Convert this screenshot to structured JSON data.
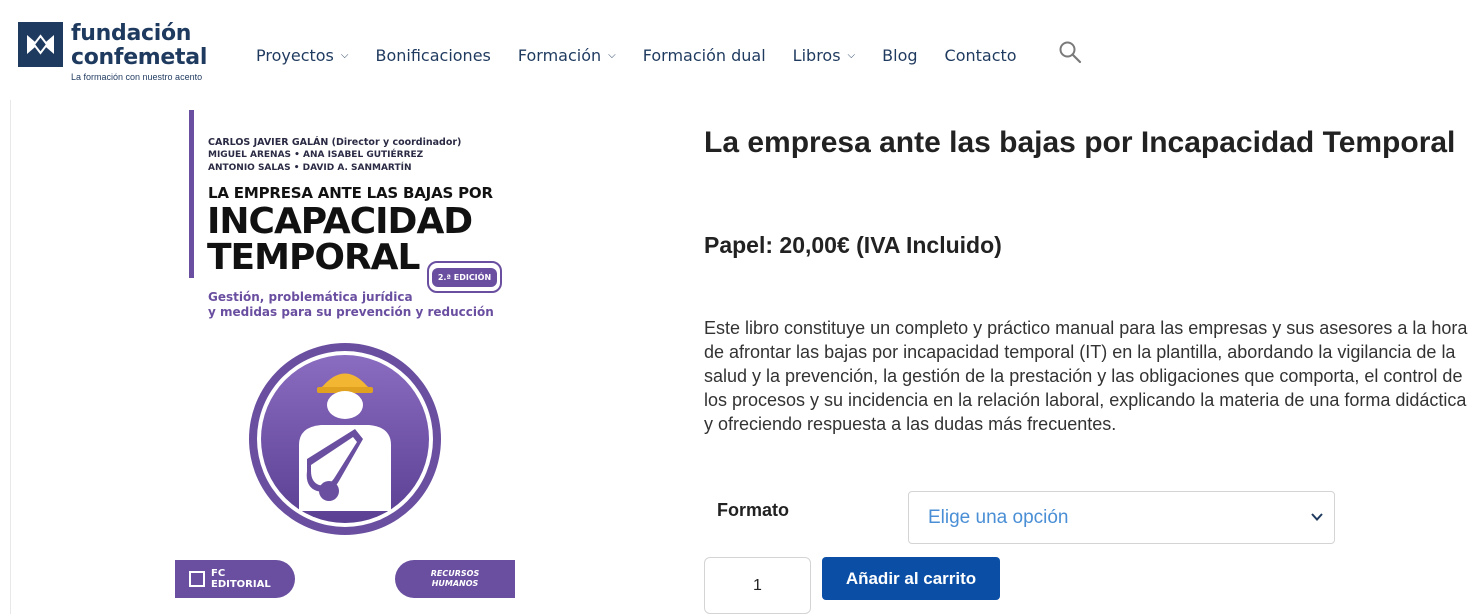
{
  "header": {
    "logo": {
      "line1": "fundación",
      "line2": "confemetal",
      "tagline": "La formación con nuestro acento"
    },
    "nav": [
      {
        "label": "Proyectos",
        "has_dropdown": true
      },
      {
        "label": "Bonificaciones",
        "has_dropdown": false
      },
      {
        "label": "Formación",
        "has_dropdown": true
      },
      {
        "label": "Formación dual",
        "has_dropdown": false
      },
      {
        "label": "Libros",
        "has_dropdown": true
      },
      {
        "label": "Blog",
        "has_dropdown": false
      },
      {
        "label": "Contacto",
        "has_dropdown": false
      }
    ],
    "chevron_glyph": "⌵",
    "search_icon": "search-icon"
  },
  "cover": {
    "authors_lead": "CARLOS JAVIER GALÁN (Director y coordinador)",
    "authors_2": "MIGUEL ARENAS  •  ANA ISABEL GUTIÉRREZ",
    "authors_3": "ANTONIO SALAS  •  DAVID A. SANMARTÍN",
    "kicker": "LA EMPRESA ANTE LAS BAJAS POR",
    "title_1": "INCAPACIDAD",
    "title_2": "TEMPORAL",
    "edition": "2.ª EDICIÓN",
    "subtitle_1": "Gestión, problemática jurídica",
    "subtitle_2": "y medidas para su prevención y reducción",
    "publisher_1": "FC",
    "publisher_2": "EDITORIAL",
    "collection_1": "RECURSOS",
    "collection_2": "HUMANOS",
    "accent_color": "#6a4fa0"
  },
  "product": {
    "title": "La empresa ante las bajas por Incapacidad Temporal",
    "price": "Papel: 20,00€ (IVA Incluido)",
    "description": "Este libro constituye un completo y práctico manual para las empresas y sus asesores a la hora de afrontar las bajas por incapacidad temporal (IT) en la plantilla, abordando la vigilancia de la salud y la prevención, la gestión de la prestación y las obligaciones que comporta, el control de los procesos y su incidencia en la relación laboral, explicando la materia de una forma didáctica y ofreciendo respuesta a las dudas más frecuentes.",
    "format_label": "Formato",
    "format_placeholder": "Elige una opción",
    "quantity": "1",
    "add_to_cart": "Añadir al carrito",
    "button_color": "#0a4ea5"
  }
}
